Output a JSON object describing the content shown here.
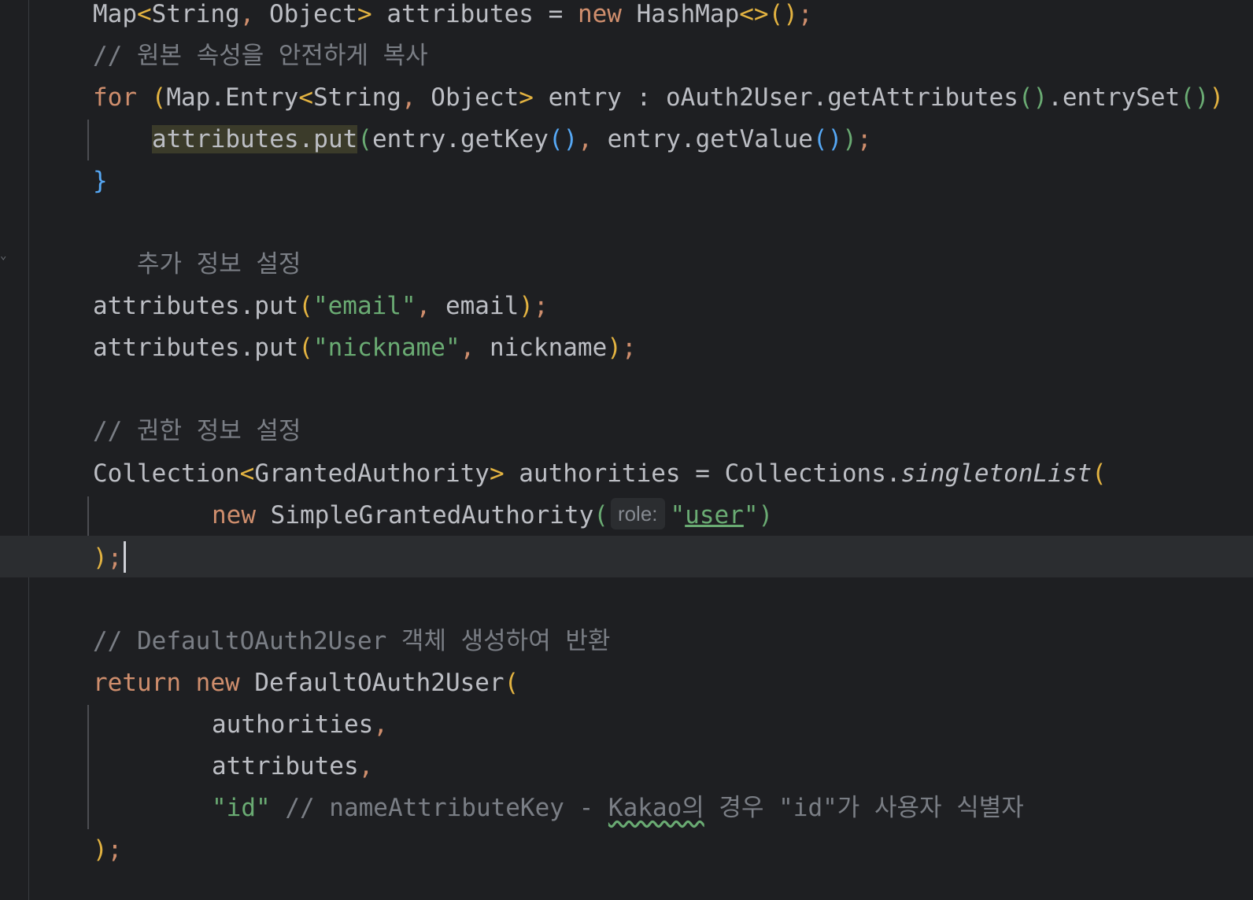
{
  "code": {
    "line01": {
      "type1": "Map",
      "lt": "<",
      "type2": "String",
      "comma": ",",
      "type3": " Object",
      "gt": ">",
      "var": " attributes = ",
      "kw_new": "new",
      "ctor": " HashMap",
      "diamond": "<>",
      "parens": "()",
      "semi": ";"
    },
    "line02": {
      "comment": "// 원본 속성을 안전하게 복사"
    },
    "line03": {
      "kw_for": "for",
      "open": " (",
      "t1": "Map.Entry",
      "lt": "<",
      "t2": "String",
      "comma": ",",
      "t3": " Object",
      "gt": ">",
      "rest": " entry : oAuth2User.getAttributes",
      "p1": "()",
      "dot": ".entrySet",
      "p2": "()",
      "close": ")"
    },
    "line04": {
      "hl": "attributes.put",
      "open": "(",
      "a1": "entry.getKey",
      "p1": "()",
      "comma": ",",
      "a2": " entry.getValue",
      "p2": "()",
      "close": ")",
      "semi": ";"
    },
    "line05": {
      "brace": "}"
    },
    "line07": {
      "comment": "추가 정보 설정"
    },
    "line08": {
      "call": "attributes.put",
      "open": "(",
      "str": "\"email\"",
      "comma": ",",
      "arg": " email",
      "close": ")",
      "semi": ";"
    },
    "line09": {
      "call": "attributes.put",
      "open": "(",
      "str": "\"nickname\"",
      "comma": ",",
      "arg": " nickname",
      "close": ")",
      "semi": ";"
    },
    "line11": {
      "comment": "// 권한 정보 설정"
    },
    "line12": {
      "type1": "Collection",
      "lt": "<",
      "type2": "GrantedAuthority",
      "gt": ">",
      "rest": " authorities = Collections.",
      "method": "singletonList",
      "open": "("
    },
    "line13": {
      "kw_new": "new",
      "ctor": " SimpleGrantedAuthority",
      "open": "(",
      "hint": "role:",
      "q1": "\"",
      "str": "user",
      "q2": "\"",
      "close": ")"
    },
    "line14": {
      "close": ")",
      "semi": ";"
    },
    "line16": {
      "comment": "// DefaultOAuth2User 객체 생성하여 반환"
    },
    "line17": {
      "kw_return": "return",
      "space": " ",
      "kw_new": "new",
      "ctor": " DefaultOAuth2User",
      "open": "("
    },
    "line18": {
      "arg": "authorities",
      "comma": ","
    },
    "line19": {
      "arg": "attributes",
      "comma": ","
    },
    "line20": {
      "str": "\"id\"",
      "comment_a": " // nameAttributeKey - ",
      "comment_b": "Kakao의",
      "comment_c": " 경우 \"id\"가 사용자 식별자"
    },
    "line21": {
      "close": ")",
      "semi": ";"
    }
  },
  "colors": {
    "background": "#1e1f22",
    "current_line": "#2b2d30",
    "keyword": "#cf8e6d",
    "string": "#6aab73",
    "comment": "#7a7e85",
    "text": "#bcbec4",
    "bracket_yellow": "#e3b341",
    "bracket_blue": "#56a8f5"
  }
}
